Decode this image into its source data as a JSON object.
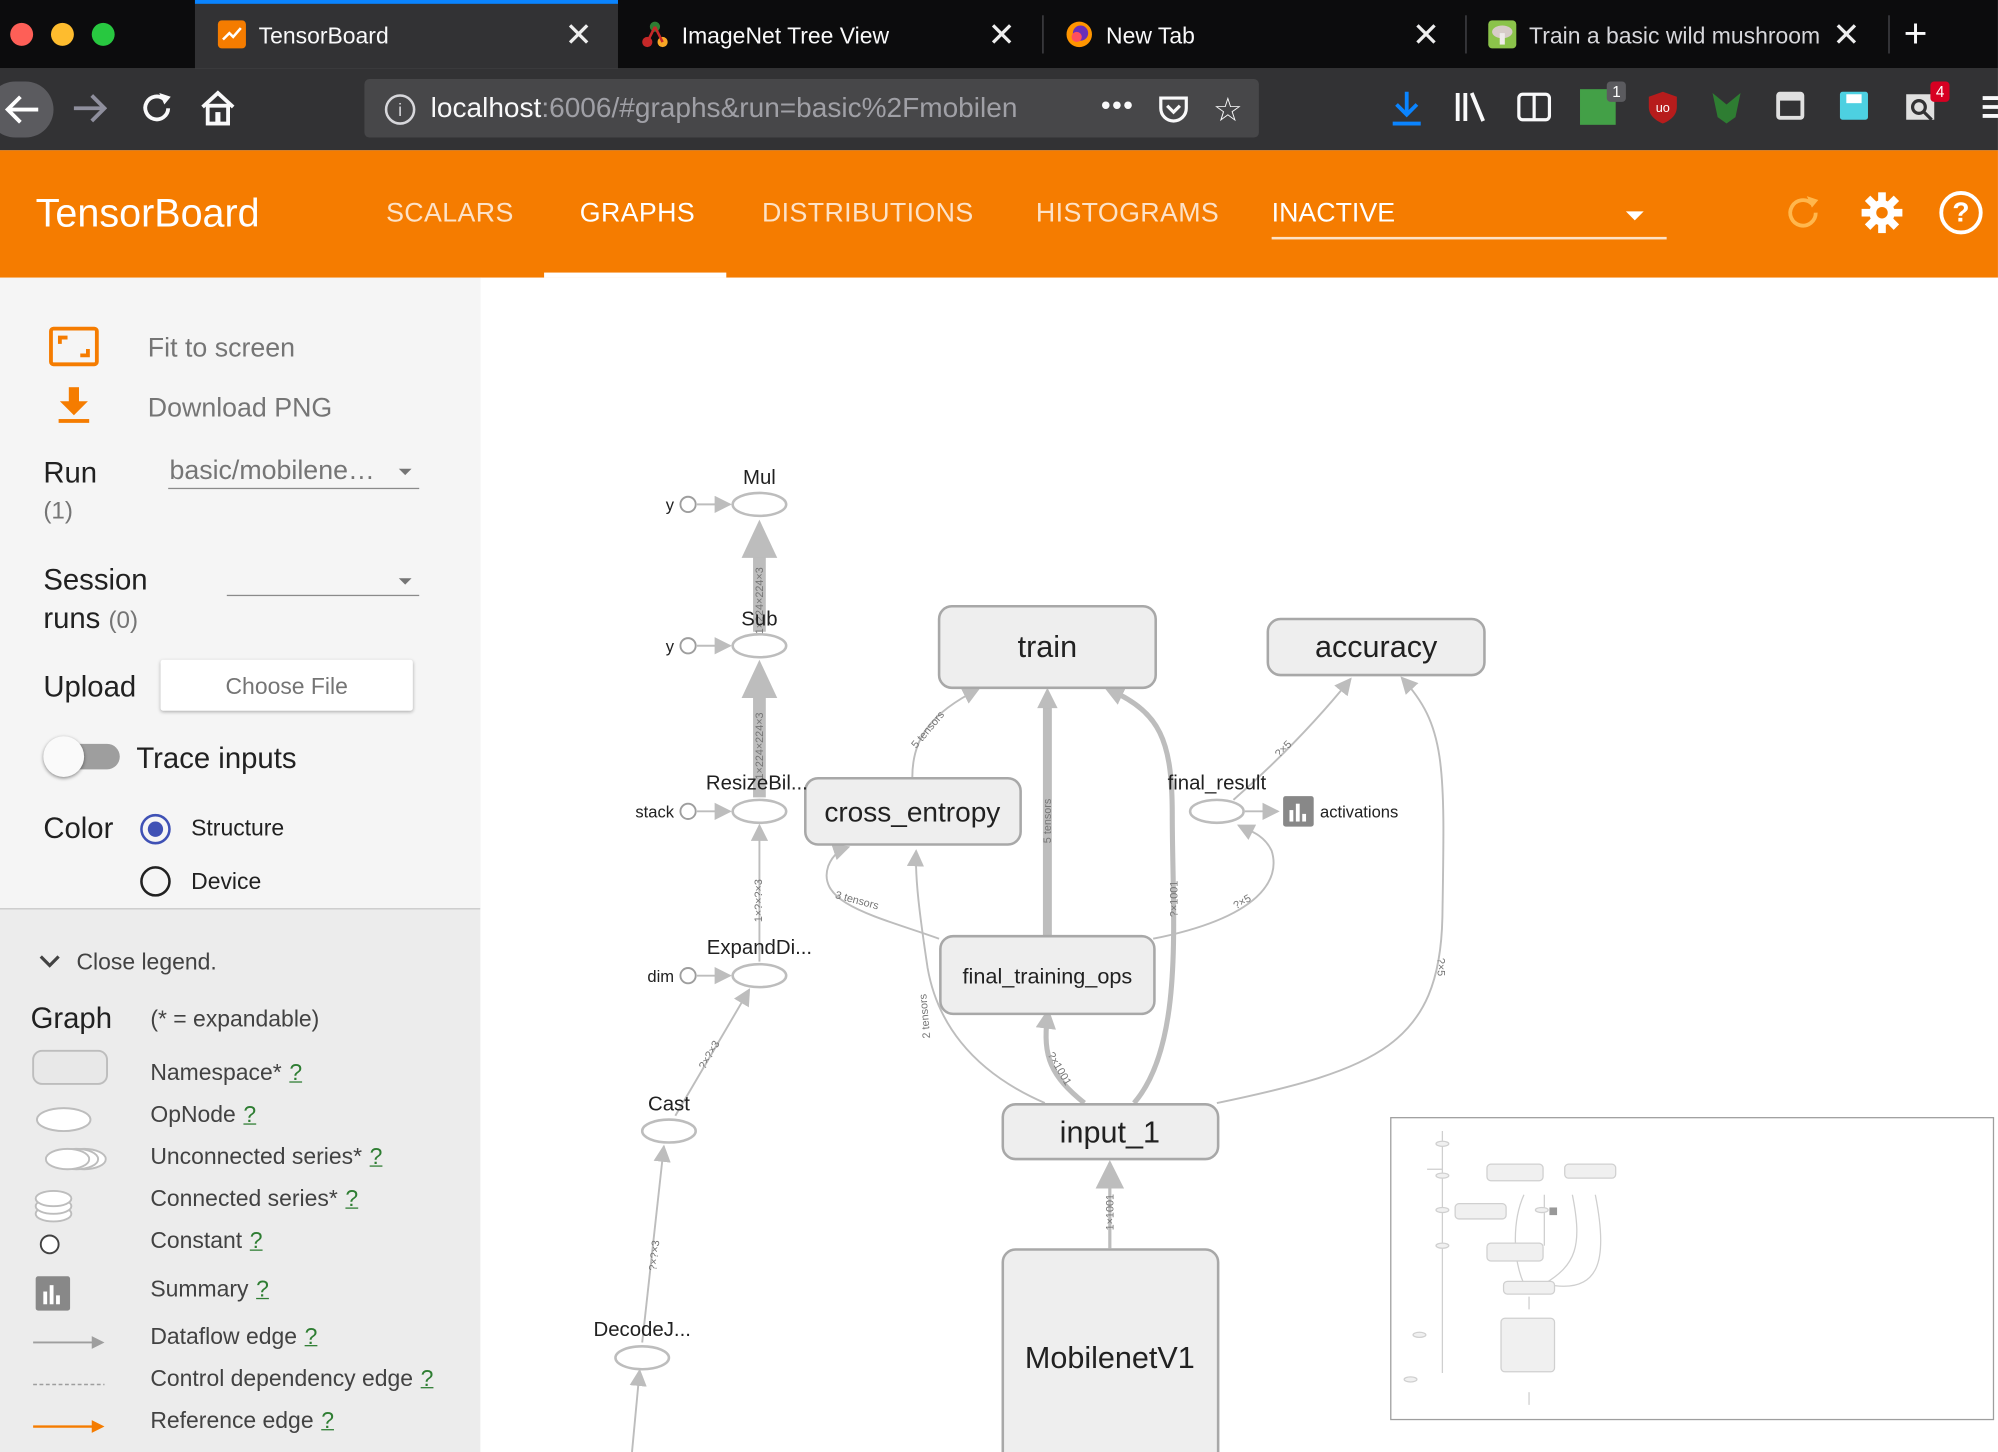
{
  "browser": {
    "tabs": [
      {
        "label": "TensorBoard",
        "active": true
      },
      {
        "label": "ImageNet Tree View",
        "active": false
      },
      {
        "label": "New Tab",
        "active": false
      },
      {
        "label": "Train a basic wild mushroom",
        "active": false
      }
    ],
    "new_tab": "+",
    "url_host": "localhost",
    "url_rest": ":6006/#graphs&run=basic%2Fmobilen",
    "badges": {
      "tab_count": "1",
      "notifications": "4"
    },
    "colors": {
      "tab_accent": "#0a84ff",
      "download": "#0a84ff"
    }
  },
  "app": {
    "title": "TensorBoard",
    "tabs": [
      "SCALARS",
      "GRAPHS",
      "DISTRIBUTIONS",
      "HISTOGRAMS"
    ],
    "active_tab": "GRAPHS",
    "inactive_select": "INACTIVE",
    "colors": {
      "header": "#f57c00"
    }
  },
  "sidebar": {
    "fit_to_screen": "Fit to screen",
    "download_png": "Download PNG",
    "run_label": "Run",
    "run_count": "(1)",
    "run_value": "basic/mobilene…",
    "session_label_1": "Session",
    "session_label_2": "runs",
    "session_count": "(0)",
    "upload_label": "Upload",
    "choose_file": "Choose File",
    "trace_inputs": "Trace inputs",
    "color_label": "Color",
    "color_options": [
      "Structure",
      "Device"
    ],
    "color_selected": "Structure"
  },
  "legend": {
    "toggle": "Close legend.",
    "graph_label": "Graph",
    "expandable_note": "(* = expandable)",
    "items": [
      "Namespace*",
      "OpNode",
      "Unconnected series*",
      "Connected series*",
      "Constant",
      "Summary",
      "Dataflow edge",
      "Control dependency edge",
      "Reference edge"
    ],
    "help": "?"
  },
  "graph": {
    "namespaces": [
      "train",
      "accuracy",
      "cross_entropy",
      "final_training_ops",
      "input_1",
      "MobilenetV1"
    ],
    "ops": [
      "Mul",
      "Sub",
      "ResizeBil...",
      "ExpandDi...",
      "Cast",
      "DecodeJ...",
      "final_result"
    ],
    "constants": [
      "y",
      "y",
      "stack",
      "dim"
    ],
    "summary": "activations",
    "edge_labels": {
      "sub_mul": "1×224×224×3",
      "resize_sub": "1×224×224×3",
      "expand_resize": "1×?×?×3",
      "cast_expand": "?×?×3",
      "decode_cast": "?×?×3",
      "ce_train": "5 tensors",
      "fto_train": "5 tensors",
      "fto_ce": "3 tensors",
      "input_ce": "2 tensors",
      "input_fto": "?×1001",
      "input_train": "?×1001",
      "fr_acc": "?×5",
      "fto_fr": "?×5",
      "input_acc": "?×5",
      "mobilenet_input": "1×1001"
    },
    "colors": {
      "node_fill": "#eeeeee",
      "node_stroke": "#a8a8a8",
      "edge": "#bdbdbd"
    }
  }
}
